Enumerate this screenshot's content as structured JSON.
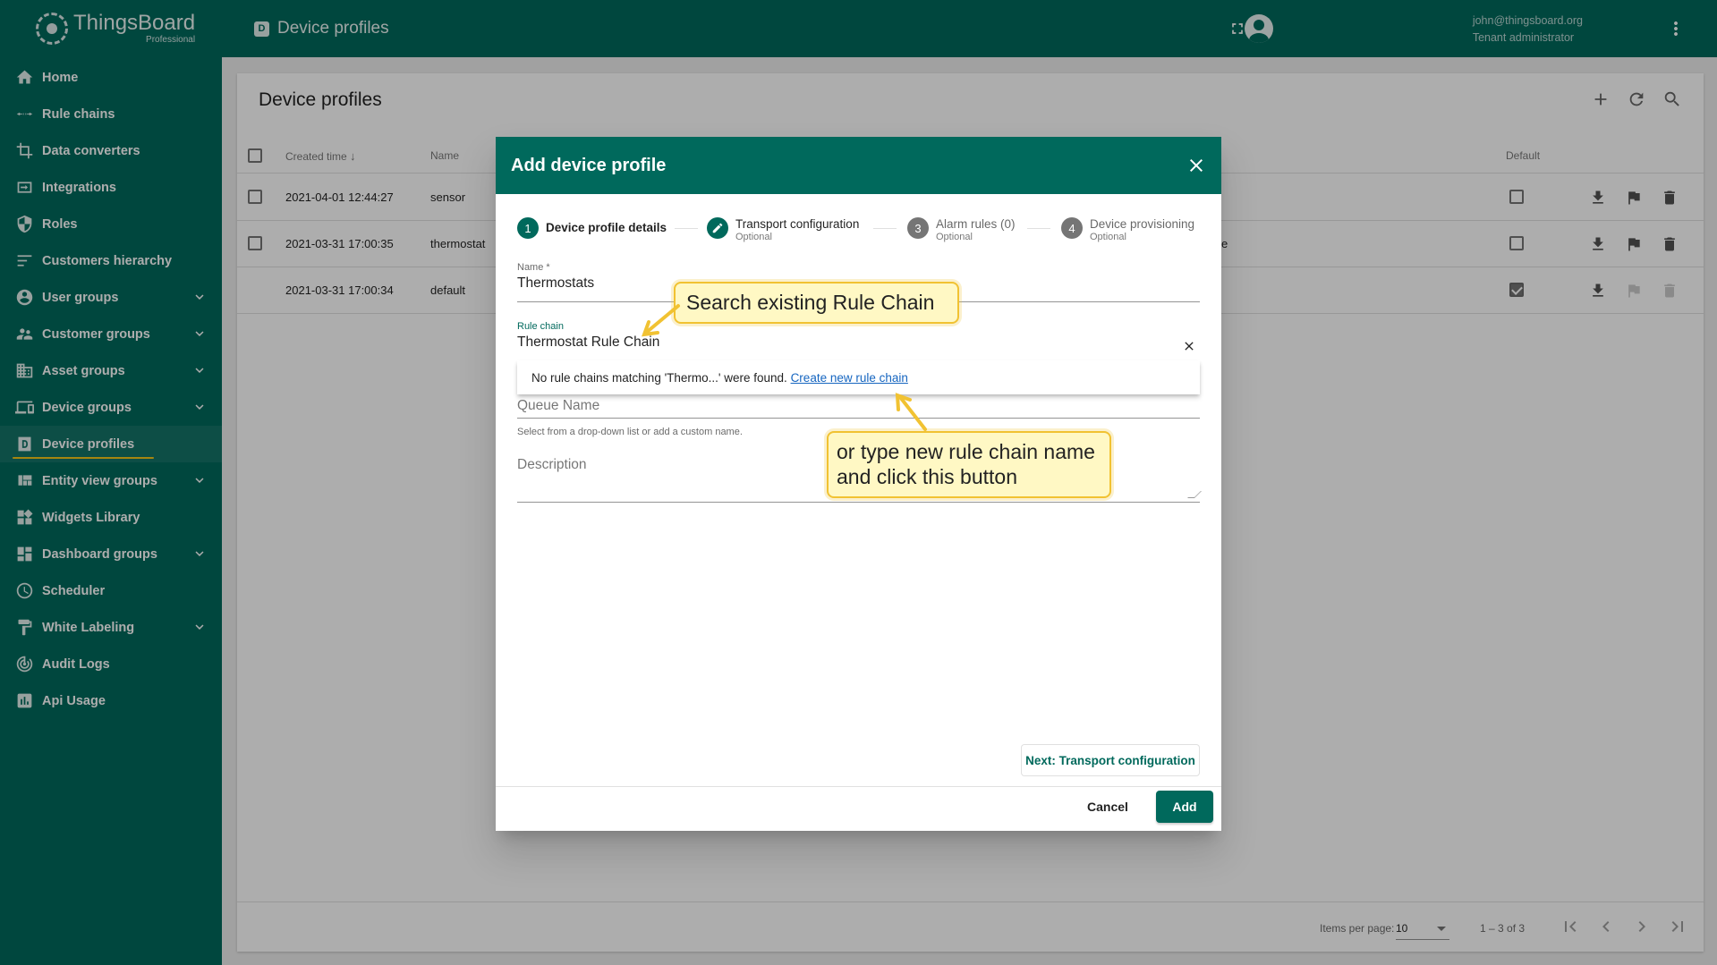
{
  "app": {
    "logo_name": "ThingsBoard",
    "logo_sub": "Professional"
  },
  "sidebar": {
    "items": [
      {
        "label": "Home",
        "icon": "home-icon",
        "expandable": false
      },
      {
        "label": "Rule chains",
        "icon": "rule-chain-icon",
        "expandable": false
      },
      {
        "label": "Data converters",
        "icon": "converter-icon",
        "expandable": false
      },
      {
        "label": "Integrations",
        "icon": "integration-icon",
        "expandable": false
      },
      {
        "label": "Roles",
        "icon": "shield-icon",
        "expandable": false
      },
      {
        "label": "Customers hierarchy",
        "icon": "hierarchy-icon",
        "expandable": false
      },
      {
        "label": "User groups",
        "icon": "account-circle-icon",
        "expandable": true
      },
      {
        "label": "Customer groups",
        "icon": "supervisor-icon",
        "expandable": true
      },
      {
        "label": "Asset groups",
        "icon": "domain-icon",
        "expandable": true
      },
      {
        "label": "Device groups",
        "icon": "devices-icon",
        "expandable": true
      },
      {
        "label": "Device profiles",
        "icon": "device-profile-icon",
        "expandable": false,
        "active": true
      },
      {
        "label": "Entity view groups",
        "icon": "view-quilt-icon",
        "expandable": true
      },
      {
        "label": "Widgets Library",
        "icon": "widgets-icon",
        "expandable": false
      },
      {
        "label": "Dashboard groups",
        "icon": "dashboard-icon",
        "expandable": true
      },
      {
        "label": "Scheduler",
        "icon": "schedule-icon",
        "expandable": false
      },
      {
        "label": "White Labeling",
        "icon": "format-paint-icon",
        "expandable": true
      },
      {
        "label": "Audit Logs",
        "icon": "track-changes-icon",
        "expandable": false
      },
      {
        "label": "Api Usage",
        "icon": "insert-chart-icon",
        "expandable": false
      }
    ]
  },
  "topbar": {
    "page_title": "Device profiles",
    "page_badge": "D",
    "user_email": "john@thingsboard.org",
    "user_role": "Tenant administrator"
  },
  "table": {
    "title": "Device profiles",
    "columns": {
      "created_time": "Created time",
      "name": "Name",
      "default": "Default"
    },
    "rows": [
      {
        "created": "2021-04-01 12:44:27",
        "name": "sensor",
        "extra": "",
        "is_default": false
      },
      {
        "created": "2021-03-31 17:00:35",
        "name": "thermostat",
        "extra": "e",
        "is_default": false
      },
      {
        "created": "2021-03-31 17:00:34",
        "name": "default",
        "extra": "",
        "is_default": true
      }
    ],
    "paginator": {
      "items_per_page_label": "Items per page:",
      "items_per_page": "10",
      "range": "1 – 3 of 3"
    }
  },
  "dialog": {
    "title": "Add device profile",
    "steps": [
      {
        "number": "1",
        "label": "Device profile details",
        "sub": "",
        "state": "active"
      },
      {
        "number": "",
        "label": "Transport configuration",
        "sub": "Optional",
        "state": "edited"
      },
      {
        "number": "3",
        "label": "Alarm rules (0)",
        "sub": "Optional",
        "state": "inactive"
      },
      {
        "number": "4",
        "label": "Device provisioning",
        "sub": "Optional",
        "state": "inactive"
      }
    ],
    "name_field": {
      "label": "Name *",
      "value": "Thermostats"
    },
    "rule_chain_field": {
      "label": "Rule chain",
      "value": "Thermostat Rule Chain"
    },
    "dropdown": {
      "message": "No rule chains matching 'Thermo...' were found.",
      "link": "Create new rule chain"
    },
    "queue_field": {
      "placeholder": "Queue Name",
      "hint": "Select from a drop-down list or add a custom name."
    },
    "description_field": {
      "placeholder": "Description"
    },
    "next_button": "Next: Transport configuration",
    "cancel_button": "Cancel",
    "add_button": "Add"
  },
  "callouts": {
    "search": "Search existing Rule Chain",
    "create_line1": "or type new rule chain name",
    "create_line2": "and click this button"
  },
  "colors": {
    "primary": "#00695c",
    "callout_bg": "#fff8c4",
    "callout_border": "#f1c232",
    "link": "#1565c0"
  }
}
